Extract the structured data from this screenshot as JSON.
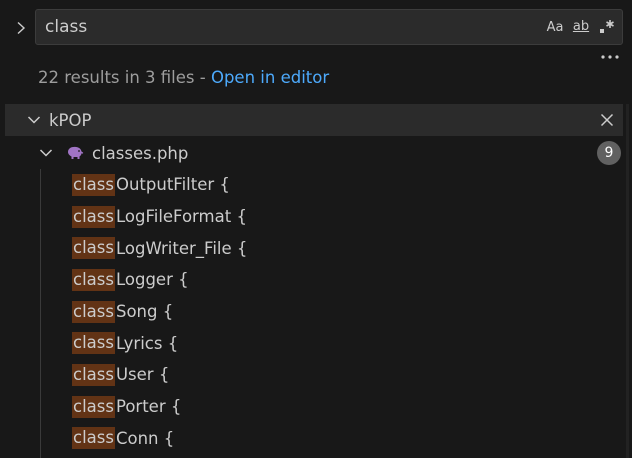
{
  "search": {
    "query": "class",
    "options": {
      "match_case": "Aa",
      "whole_word": "ab",
      "regex": ".*"
    }
  },
  "summary": {
    "text": "22 results in 3 files - ",
    "link": "Open in editor"
  },
  "tree": {
    "folder": {
      "name": "kPOP",
      "files": [
        {
          "name": "classes.php",
          "match_count": "9",
          "matches": [
            {
              "highlight": "class",
              "rest": "OutputFilter {"
            },
            {
              "highlight": "class",
              "rest": "LogFileFormat {"
            },
            {
              "highlight": "class",
              "rest": "LogWriter_File {"
            },
            {
              "highlight": "class",
              "rest": "Logger {"
            },
            {
              "highlight": "class",
              "rest": "Song {"
            },
            {
              "highlight": "class",
              "rest": "Lyrics {"
            },
            {
              "highlight": "class",
              "rest": "User {"
            },
            {
              "highlight": "class",
              "rest": "Porter {"
            },
            {
              "highlight": "class",
              "rest": "Conn {"
            }
          ]
        }
      ]
    }
  },
  "colors": {
    "background": "#181818",
    "input_background": "#2b2b2b",
    "link": "#4daafc",
    "match_highlight": "#623315",
    "badge": "#616161",
    "php_icon": "#a074c4"
  }
}
